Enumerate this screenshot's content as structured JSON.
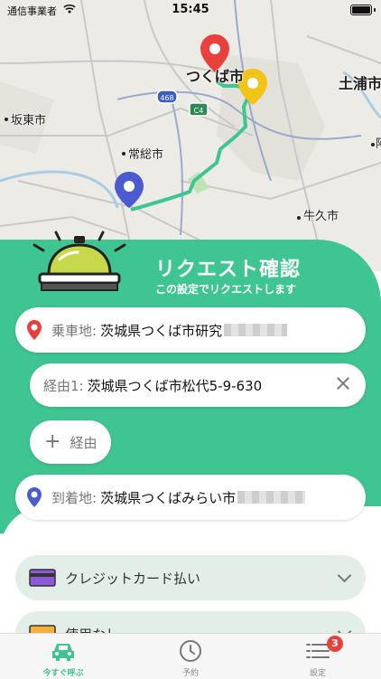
{
  "status_bar": {
    "carrier": "通信事業者",
    "time": "15:45"
  },
  "map": {
    "labels": {
      "tsukuba": "つくば市",
      "tsuchiura": "土浦市",
      "bando": "坂東市",
      "joso": "常総市",
      "ushiku": "牛久市",
      "route_468": "468",
      "route_c4": "C4",
      "edge_char": "阿"
    },
    "colors": {
      "route": "#3fc591",
      "pickup_pin": "#e8413d",
      "waypoint_pin": "#f2c418",
      "dropoff_pin": "#4a5bcf"
    }
  },
  "request": {
    "title": "リクエスト確認",
    "subtitle": "この設定でリクエストします",
    "pickup": {
      "label": "乗車地:",
      "value": "茨城県つくば市研究"
    },
    "waypoint": {
      "label": "経由1:",
      "value": "茨城県つくば市松代5-9-630"
    },
    "add_waypoint_label": "経由",
    "dropoff": {
      "label": "到着地:",
      "value": "茨城県つくばみらい市"
    }
  },
  "payment": {
    "method_label": "クレジットカード払い"
  },
  "coupon": {
    "label": "使用なし"
  },
  "tabs": [
    {
      "label": "今すぐ呼ぶ",
      "active": true
    },
    {
      "label": "予約",
      "active": false
    },
    {
      "label": "設定",
      "active": false,
      "badge": "3"
    }
  ],
  "accent_color": "#3fc591"
}
